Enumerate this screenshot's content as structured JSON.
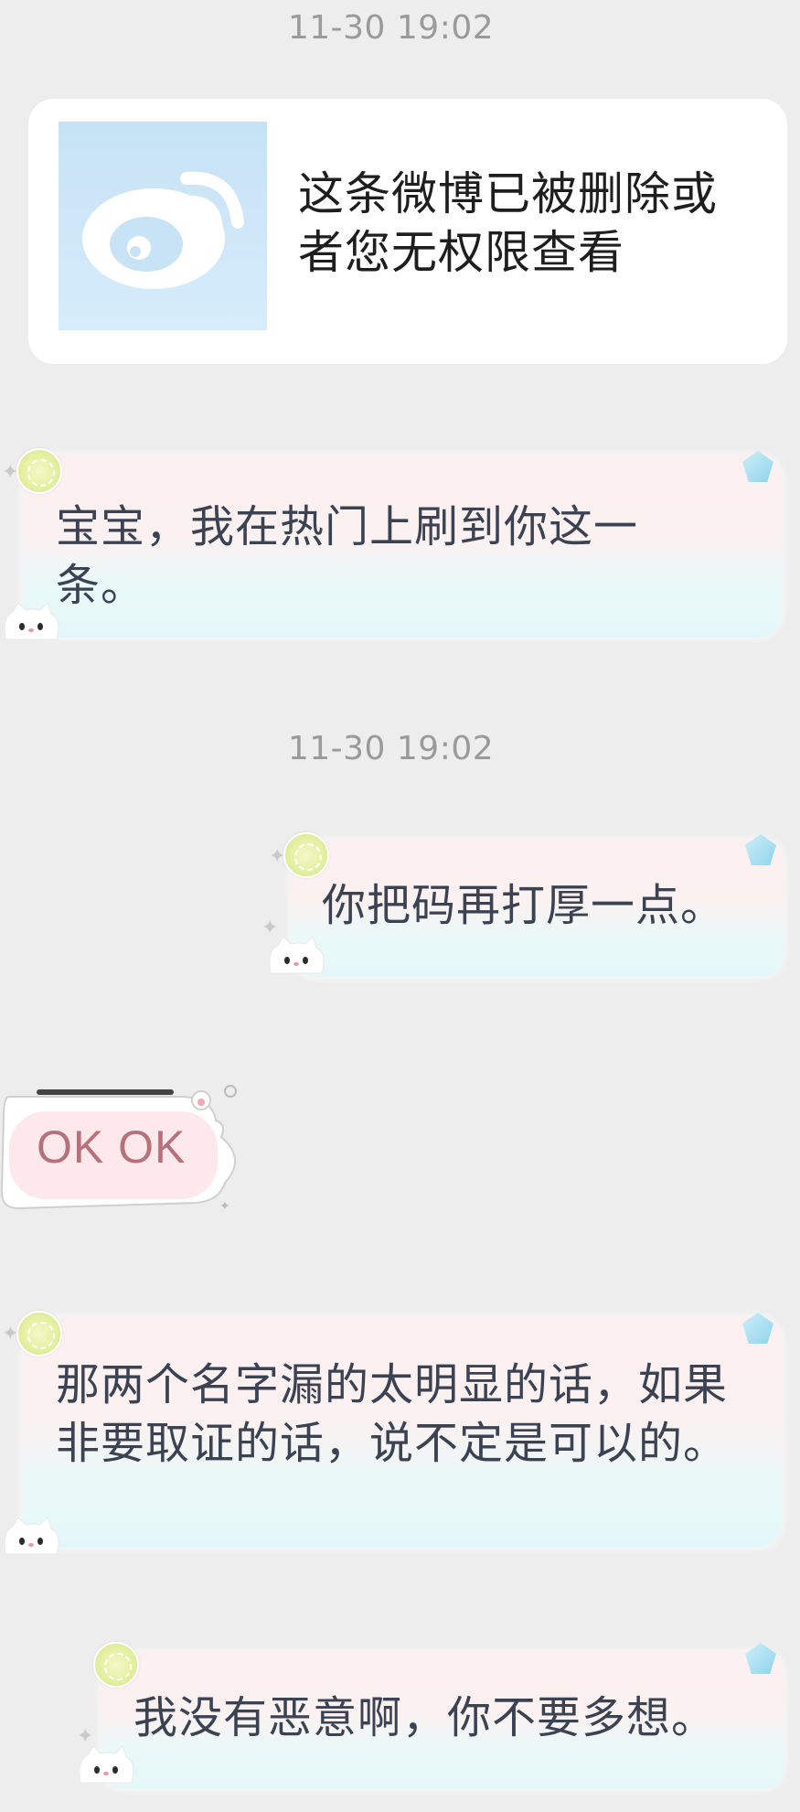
{
  "timestamps": [
    "11-30 19:02",
    "11-30 19:02"
  ],
  "shared_post": {
    "icon": "weibo-logo-icon",
    "text": "这条微博已被删除或者您无权限查看"
  },
  "messages": [
    {
      "side": "left",
      "text": "宝宝，我在热门上刷到你这一条。"
    },
    {
      "side": "right",
      "text": "你把码再打厚一点。"
    },
    {
      "side": "left",
      "sticker": true,
      "text": "OK OK"
    },
    {
      "side": "left",
      "text": "那两个名字漏的太明显的话，如果非要取证的话，说不定是可以的。"
    },
    {
      "side": "right",
      "text": "我没有恶意啊，你不要多想。"
    }
  ],
  "colors": {
    "background": "#ededed",
    "timestamp": "#9a9a9a",
    "bubble_text": "#3b4353",
    "sticker_text": "#b5727a"
  }
}
